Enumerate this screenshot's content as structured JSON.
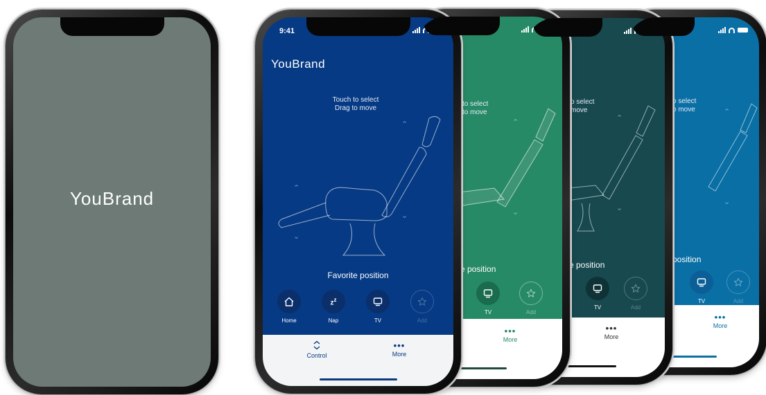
{
  "brand": {
    "logo_text": "YouBrand"
  },
  "status": {
    "time": "9:41"
  },
  "hint": {
    "line1": "Touch to select",
    "line2": "Drag to move"
  },
  "hint_partial": {
    "line1": "to select",
    "line2": "to move"
  },
  "hint_partial2": {
    "line1": "o select",
    "line2": "move"
  },
  "hint_partial3": {
    "line1": "o select",
    "line2": "o move"
  },
  "favorites": {
    "title": "Favorite position",
    "title_partial_green": "e position",
    "title_partial_teal": "e position",
    "title_partial_blue": "position",
    "items": [
      {
        "label": "Home",
        "icon": "home-icon"
      },
      {
        "label": "Nap",
        "icon": "nap-icon"
      },
      {
        "label": "TV",
        "icon": "tv-icon"
      },
      {
        "label": "Add",
        "icon": "star-icon"
      }
    ]
  },
  "nav": {
    "control_label": "Control",
    "more_label": "More"
  },
  "colors": {
    "splash": "#6d7a75",
    "navy": "#063a84",
    "green": "#278a66",
    "teal": "#17494f",
    "blue": "#0a6fa5",
    "nav_bg": "#f3f4f6"
  }
}
